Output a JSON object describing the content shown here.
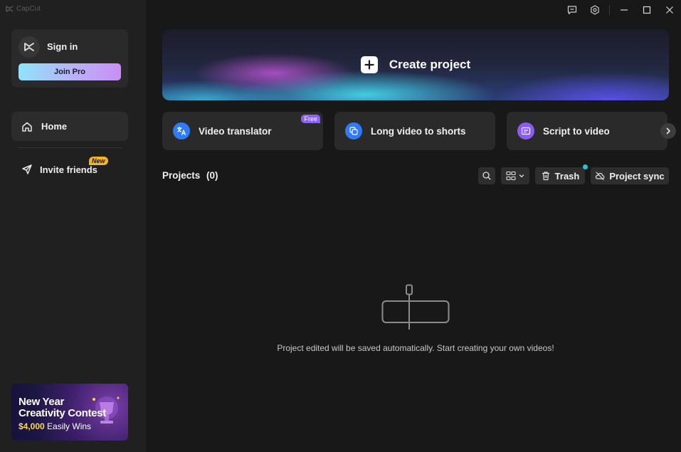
{
  "app": {
    "title": "CapCut"
  },
  "sidebar": {
    "sign_in_label": "Sign in",
    "join_pro_label": "Join Pro",
    "nav": [
      {
        "label": "Home",
        "icon": "home-icon",
        "active": true
      },
      {
        "label": "Invite friends",
        "icon": "send-icon",
        "badge": "New"
      }
    ],
    "promo": {
      "line1": "New Year",
      "line2": "Creativity Contest",
      "prize_amount": "$4,000",
      "prize_text": "Easily Wins"
    }
  },
  "window_controls": [
    "feedback-icon",
    "settings-icon",
    "minimize-icon",
    "maximize-icon",
    "close-icon"
  ],
  "main": {
    "create_label": "Create project",
    "tools": [
      {
        "label": "Video translator",
        "icon": "translate-icon",
        "color": "#2f7bf5",
        "badge": "Free"
      },
      {
        "label": "Long video to shorts",
        "icon": "clip-icon",
        "color": "#2f7bf5"
      },
      {
        "label": "Script to video",
        "icon": "script-icon",
        "color": "#8a5cf5"
      }
    ],
    "projects": {
      "title": "Projects",
      "count": "(0)",
      "trash_label": "Trash",
      "sync_label": "Project sync",
      "empty_message": "Project edited will be saved automatically. Start creating your own videos!"
    }
  },
  "colors": {
    "sidebar_bg": "#202020",
    "main_bg": "#181818",
    "card_bg": "#2a2a2a",
    "accent_cyan": "#22c7cf",
    "new_badge": "#f7b322",
    "free_badge": "#8a63f0"
  }
}
